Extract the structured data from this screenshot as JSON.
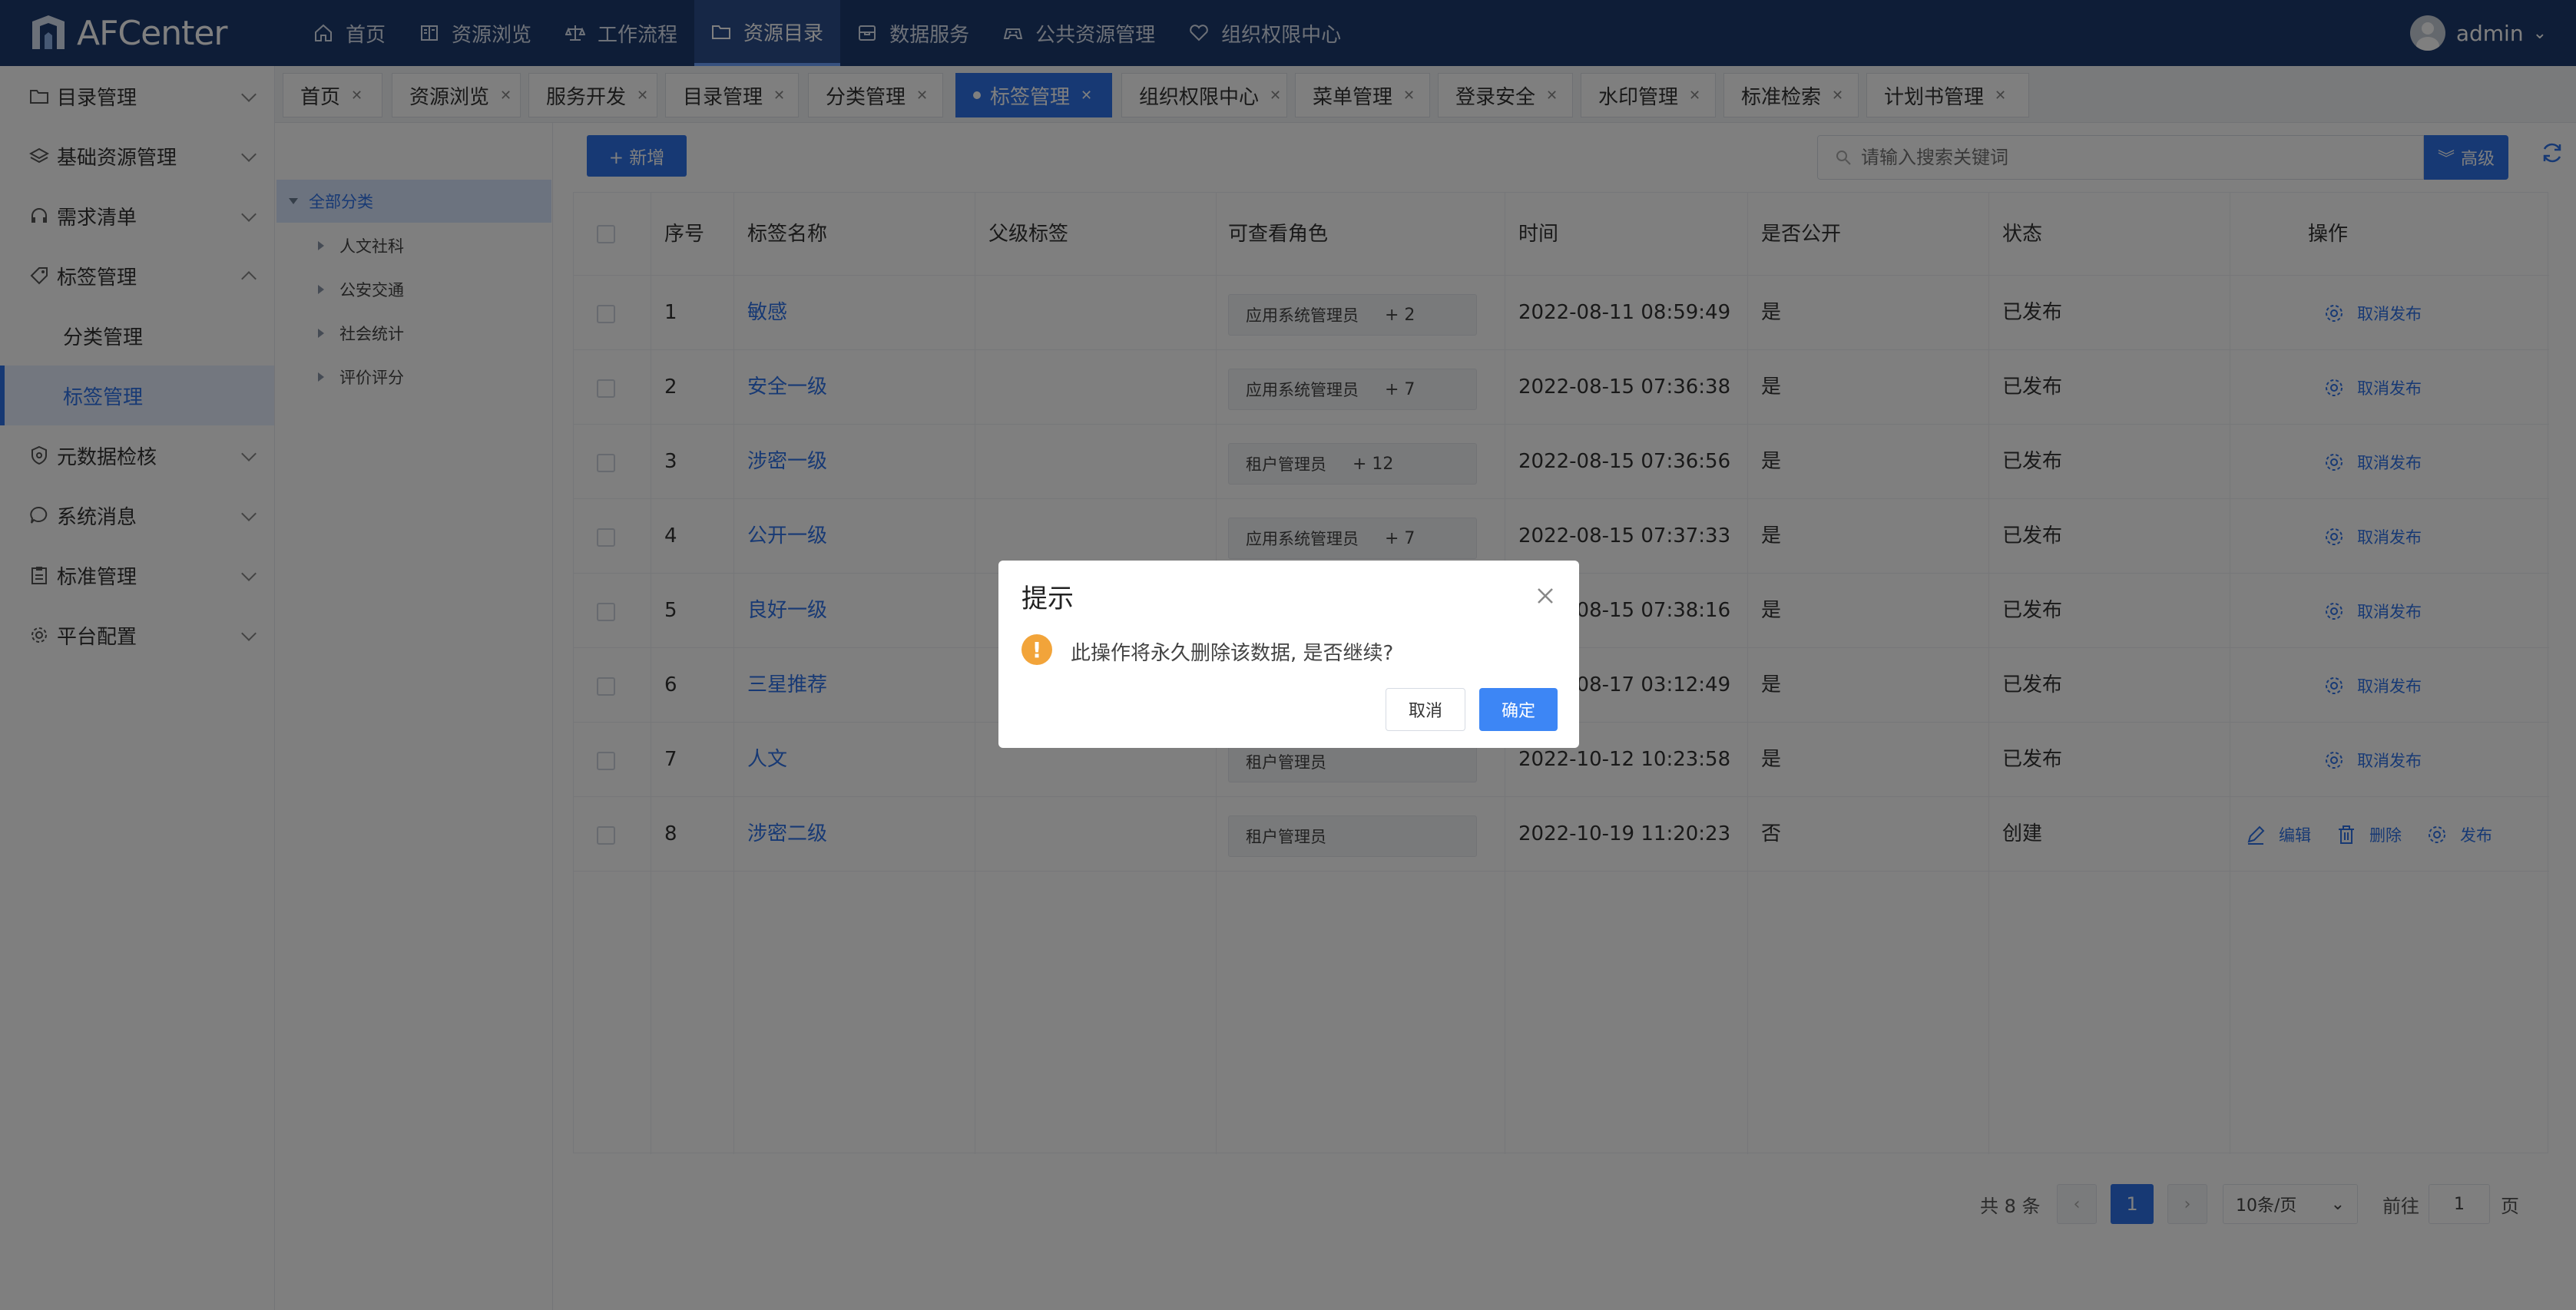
{
  "app": {
    "name": "AFCenter",
    "user": "admin"
  },
  "top_nav": [
    {
      "label": "首页",
      "icon": "home-icon"
    },
    {
      "label": "资源浏览",
      "icon": "book-icon"
    },
    {
      "label": "工作流程",
      "icon": "scale-icon"
    },
    {
      "label": "资源目录",
      "icon": "folder-icon",
      "active": true
    },
    {
      "label": "数据服务",
      "icon": "archive-icon"
    },
    {
      "label": "公共资源管理",
      "icon": "gamepad-icon"
    },
    {
      "label": "组织权限中心",
      "icon": "heart-icon"
    }
  ],
  "sidebar": {
    "items": [
      {
        "label": "目录管理",
        "icon": "folder-icon"
      },
      {
        "label": "基础资源管理",
        "icon": "layers-icon"
      },
      {
        "label": "需求清单",
        "icon": "headset-icon"
      },
      {
        "label": "标签管理",
        "icon": "tag-icon",
        "expanded": true
      },
      {
        "label": "元数据检核",
        "icon": "shield-icon"
      },
      {
        "label": "系统消息",
        "icon": "chat-icon"
      },
      {
        "label": "标准管理",
        "icon": "clipboard-icon"
      },
      {
        "label": "平台配置",
        "icon": "gear-icon"
      }
    ],
    "sub_items": [
      {
        "label": "分类管理"
      },
      {
        "label": "标签管理",
        "active": true
      }
    ]
  },
  "tabs": [
    {
      "label": "首页"
    },
    {
      "label": "资源浏览"
    },
    {
      "label": "服务开发"
    },
    {
      "label": "目录管理"
    },
    {
      "label": "分类管理"
    },
    {
      "label": "标签管理",
      "active": true
    },
    {
      "label": "组织权限中心"
    },
    {
      "label": "菜单管理"
    },
    {
      "label": "登录安全"
    },
    {
      "label": "水印管理"
    },
    {
      "label": "标准检索"
    },
    {
      "label": "计划书管理"
    }
  ],
  "tree": {
    "root": "全部分类",
    "children": [
      "人文社科",
      "公安交通",
      "社会统计",
      "评价评分"
    ]
  },
  "toolbar": {
    "add_label": "+ 新增",
    "search_placeholder": "请输入搜索关键词",
    "advanced_label": "高级"
  },
  "table": {
    "columns": [
      "序号",
      "标签名称",
      "父级标签",
      "可查看角色",
      "时间",
      "是否公开",
      "状态",
      "操作"
    ],
    "rows": [
      {
        "no": "1",
        "name": "敏感",
        "parent": "",
        "role": "应用系统管理员",
        "role_more": "+ 2",
        "time": "2022-08-11 08:59:49",
        "public": "是",
        "status": "已发布",
        "ops": [
          "取消发布"
        ]
      },
      {
        "no": "2",
        "name": "安全一级",
        "parent": "",
        "role": "应用系统管理员",
        "role_more": "+ 7",
        "time": "2022-08-15 07:36:38",
        "public": "是",
        "status": "已发布",
        "ops": [
          "取消发布"
        ]
      },
      {
        "no": "3",
        "name": "涉密一级",
        "parent": "",
        "role": "租户管理员",
        "role_more": "+ 12",
        "time": "2022-08-15 07:36:56",
        "public": "是",
        "status": "已发布",
        "ops": [
          "取消发布"
        ]
      },
      {
        "no": "4",
        "name": "公开一级",
        "parent": "",
        "role": "应用系统管理员",
        "role_more": "+ 7",
        "time": "2022-08-15 07:37:33",
        "public": "是",
        "status": "已发布",
        "ops": [
          "取消发布"
        ]
      },
      {
        "no": "5",
        "name": "良好一级",
        "parent": "",
        "role": "",
        "role_more": "",
        "time": "2022-08-15 07:38:16",
        "public": "是",
        "status": "已发布",
        "ops": [
          "取消发布"
        ]
      },
      {
        "no": "6",
        "name": "三星推荐",
        "parent": "",
        "role": "",
        "role_more": "",
        "time": "2022-08-17 03:12:49",
        "public": "是",
        "status": "已发布",
        "ops": [
          "取消发布"
        ]
      },
      {
        "no": "7",
        "name": "人文",
        "parent": "",
        "role": "租户管理员",
        "role_more": "",
        "time": "2022-10-12 10:23:58",
        "public": "是",
        "status": "已发布",
        "ops": [
          "取消发布"
        ]
      },
      {
        "no": "8",
        "name": "涉密二级",
        "parent": "",
        "role": "租户管理员",
        "role_more": "",
        "time": "2022-10-19 11:20:23",
        "public": "否",
        "status": "创建",
        "ops": [
          "编辑",
          "删除",
          "发布"
        ]
      }
    ]
  },
  "pagination": {
    "total": "共 8 条",
    "current": "1",
    "page_size": "10条/页",
    "goto_prefix": "前往",
    "goto_value": "1",
    "goto_suffix": "页"
  },
  "dialog": {
    "title": "提示",
    "message": "此操作将永久删除该数据, 是否继续?",
    "cancel": "取消",
    "confirm": "确定"
  },
  "colors": {
    "topbar": "#1d3a6e",
    "primary": "#2f73e8",
    "warning": "#f2a43a",
    "mask": "rgba(0,0,0,0.5)"
  }
}
